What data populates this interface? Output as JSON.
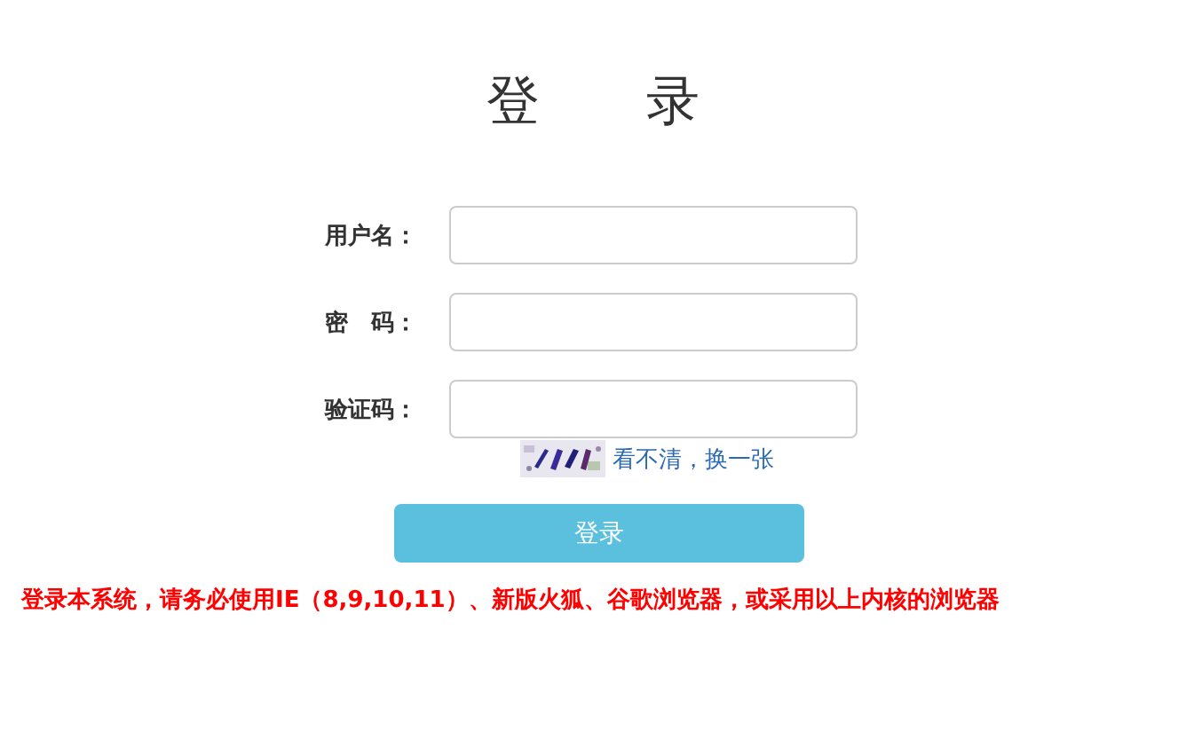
{
  "title": "登　　录",
  "fields": [
    {
      "label": "用户名："
    },
    {
      "label": "密　码："
    },
    {
      "label": "验证码："
    }
  ],
  "captcha": {
    "kind": "picture",
    "refresh_link": "看不清，换一张"
  },
  "login_button": "登录",
  "notice": "登录本系统，请务必使用IE（8,9,10,11）、新版火狐、谷歌浏览器，或采用以上内核的浏览器"
}
